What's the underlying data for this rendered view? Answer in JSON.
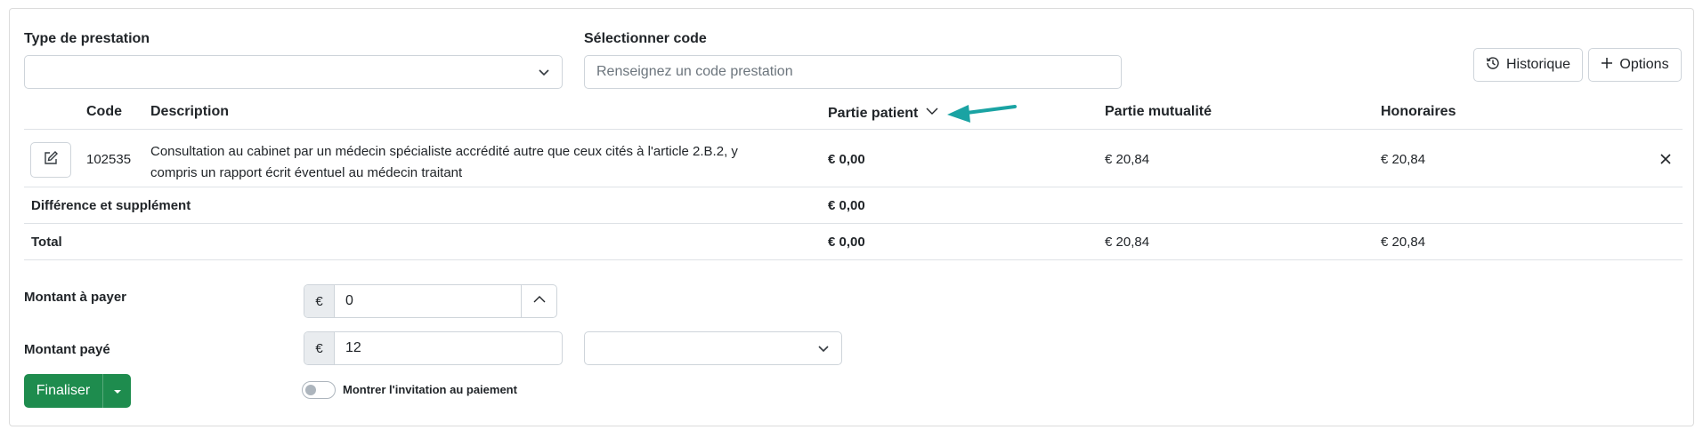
{
  "filters": {
    "type_label": "Type de prestation",
    "type_value": "",
    "code_label": "Sélectionner code",
    "code_placeholder": "Renseignez un code prestation"
  },
  "actions": {
    "history_label": "Historique",
    "options_label": "Options"
  },
  "table": {
    "headers": {
      "code": "Code",
      "description": "Description",
      "patient": "Partie patient",
      "mutualite": "Partie mutualité",
      "honoraires": "Honoraires"
    },
    "rows": [
      {
        "code": "102535",
        "description_line1": "Consultation au cabinet par un médecin spécialiste accrédité autre que ceux cités à l'article 2.B.2, y",
        "description_line2": "compris un rapport écrit éventuel au médecin traitant",
        "patient": "€ 0,00",
        "mutualite": "€ 20,84",
        "honoraires": "€ 20,84"
      }
    ],
    "difference": {
      "label": "Différence et supplément",
      "patient": "€ 0,00"
    },
    "total": {
      "label": "Total",
      "patient": "€ 0,00",
      "mutualite": "€ 20,84",
      "honoraires": "€ 20,84"
    }
  },
  "payment": {
    "amount_due_label": "Montant à payer",
    "amount_due_value": "0",
    "amount_paid_label": "Montant payé",
    "amount_paid_value": "12",
    "currency_symbol": "€",
    "method_value": ""
  },
  "footer": {
    "finalise_label": "Finaliser",
    "toggle_label": "Montrer l'invitation au paiement",
    "toggle_on": false
  },
  "colors": {
    "primary_green": "#1e8c4e",
    "arrow_teal": "#1aa3a3"
  }
}
